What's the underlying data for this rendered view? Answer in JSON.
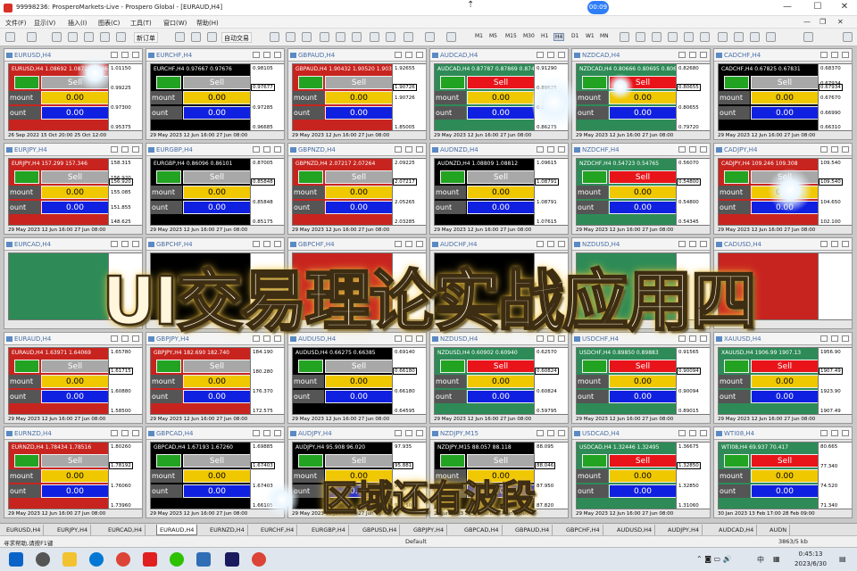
{
  "window": {
    "title": "99998236: ProsperoMarkets-Live - Prospero Global - [EURAUD,H4]",
    "timer": "00:09"
  },
  "menu": [
    "文件(F)",
    "显示(V)",
    "插入(I)",
    "图表(C)",
    "工具(T)",
    "窗口(W)",
    "帮助(H)"
  ],
  "toolbar": {
    "new_order": "新订单",
    "auto_trade": "自动交易",
    "timeframes": [
      "M1",
      "M5",
      "M15",
      "M30",
      "H1",
      "H4",
      "D1",
      "W1",
      "MN"
    ]
  },
  "labels": {
    "sell": "Sell",
    "amount": "mount",
    "count": "ount",
    "amount_alt": "amount",
    "value": "0.00"
  },
  "colors": {
    "red_bg": "#c8241f",
    "green_bg": "#2e8b57",
    "black_bg": "#000000",
    "sell_red": "#e8141a",
    "sell_gray": "#a8a8a8",
    "amount_yellow": "#f0c800",
    "count_blue": "#1020e0"
  },
  "charts": [
    {
      "window": "EURUSD,H4",
      "header": "EURUSD,H4 1.08692 1.08725 1.08666",
      "bg": "red",
      "sell": "gray",
      "prices": [
        "1.01150",
        "0.99225",
        "0.97300",
        "0.95375"
      ],
      "current": "",
      "x": "26 Sep 2022   15 Oct 20:00   25 Oct 12:00"
    },
    {
      "window": "EURCHF,H4",
      "header": "EURCHF,H4 0.97667 0.97676",
      "bg": "black",
      "sell": "gray",
      "prices": [
        "0.98105",
        "0.97870",
        "0.97285",
        "0.96685"
      ],
      "current": "0.97677",
      "x": "29 May 2023   12 Jun 16:00   27 Jun 08:00"
    },
    {
      "window": "GBPAUD,H4",
      "header": "GBPAUD,H4 1.90432 1.90520 1.90387",
      "bg": "red",
      "sell": "gray",
      "prices": [
        "1.92655",
        "1.90726",
        "1.85005"
      ],
      "current": "1.90726",
      "x": "29 May 2023   12 Jun 16:00   27 Jun 08:00"
    },
    {
      "window": "AUDCAD,H4",
      "header": "AUDCAD,H4 0.87787 0.87869 0.87450",
      "bg": "green",
      "sell": "red",
      "prices": [
        "0.91290",
        "0.89625",
        "0.87950",
        "0.86275"
      ],
      "current": "",
      "x": "29 May 2023   12 Jun 16:00   27 Jun 08:00"
    },
    {
      "window": "NZDCAD,H4",
      "header": "NZDCAD,H4 0.80666 0.80695 0.80615",
      "bg": "green",
      "sell": "red",
      "prices": [
        "0.82680",
        "0.81200",
        "0.80655",
        "0.79720"
      ],
      "current": "0.80655",
      "x": "29 May 2023   12 Jun 16:00   27 Jun 08:00"
    },
    {
      "window": "CADCHF,H4",
      "header": "CADCHF,H4 0.67825 0.67831",
      "bg": "black",
      "sell": "gray",
      "prices": [
        "0.68370",
        "0.67934",
        "0.67670",
        "0.66990",
        "0.66310"
      ],
      "current": "0.67934",
      "x": "29 May 2023   12 Jun 16:00   27 Jun 08:00"
    },
    {
      "window": "EURJPY,H4",
      "header": "EURJPY,H4 157.299 157.346",
      "bg": "red",
      "sell": "gray",
      "prices": [
        "158.315",
        "156.920",
        "155.085",
        "151.855",
        "148.625"
      ],
      "current": "156.920",
      "x": "29 May 2023   12 Jun 16:00   27 Jun 08:00"
    },
    {
      "window": "EURGBP,H4",
      "header": "EURGBP,H4 0.86096 0.86101",
      "bg": "black",
      "sell": "gray",
      "prices": [
        "0.87005",
        "0.86390",
        "0.85848",
        "0.85175"
      ],
      "current": "0.85848",
      "x": "29 May 2023   12 Jun 16:00   27 Jun 08:00"
    },
    {
      "window": "GBPNZD,H4",
      "header": "GBPNZD,H4 2.07217 2.07264",
      "bg": "red",
      "sell": "gray",
      "prices": [
        "2.09225",
        "2.07217",
        "2.05265",
        "2.03285"
      ],
      "current": "2.07217",
      "x": "29 May 2023   12 Jun 16:00   27 Jun 08:00"
    },
    {
      "window": "AUDNZD,H4",
      "header": "AUDNZD,H4 1.08809 1.08812",
      "bg": "black",
      "sell": "gray",
      "prices": [
        "1.09615",
        "1.08805",
        "1.08791",
        "1.07615"
      ],
      "current": "1.08791",
      "x": "29 May 2023   12 Jun 16:00   27 Jun 08:00"
    },
    {
      "window": "NZDCHF,H4",
      "header": "NZDCHF,H4 0.54723 0.54765",
      "bg": "green",
      "sell": "red",
      "prices": [
        "0.56070",
        "0.55300",
        "0.54800",
        "0.54345"
      ],
      "current": "0.54800",
      "x": "29 May 2023   12 Jun 16:00   27 Jun 08:00"
    },
    {
      "window": "CADJPY,H4",
      "header": "CADJPY,H4 109.246 109.308",
      "bg": "red",
      "sell": "gray",
      "prices": [
        "109.540",
        "107.200",
        "104.650",
        "102.100"
      ],
      "current": "109.540",
      "x": "29 May 2023   12 Jun 16:00   27 Jun 08:00"
    },
    {
      "window": "EURCAD,H4",
      "header": "",
      "bg": "green",
      "sell": "",
      "prices": [],
      "current": "",
      "x": ""
    },
    {
      "window": "GBPCHF,H4",
      "header": "",
      "bg": "black",
      "sell": "",
      "prices": [],
      "current": "",
      "x": ""
    },
    {
      "window": "GBPCHF,H4",
      "header": "",
      "bg": "red",
      "sell": "",
      "prices": [],
      "current": "",
      "x": ""
    },
    {
      "window": "AUDCHF,H4",
      "header": "",
      "bg": "black",
      "sell": "",
      "prices": [],
      "current": "",
      "x": ""
    },
    {
      "window": "NZDUSD,H4",
      "header": "",
      "bg": "green",
      "sell": "",
      "prices": [],
      "current": "",
      "x": ""
    },
    {
      "window": "CADUSD,H4",
      "header": "",
      "bg": "red",
      "sell": "",
      "prices": [],
      "current": "",
      "x": ""
    },
    {
      "window": "EURAUD,H4",
      "header": "EURAUD,H4 1.63971 1.64069",
      "bg": "red",
      "sell": "gray",
      "prices": [
        "1.65780",
        "1.61715",
        "1.60880",
        "1.58500"
      ],
      "current": "1.61715",
      "x": "29 May 2023   12 Jun 16:00   27 Jun 08:00"
    },
    {
      "window": "GBPJPY,H4",
      "header": "GBPJPY,H4 182.690 182.740",
      "bg": "red",
      "sell": "gray",
      "prices": [
        "184.190",
        "180.280",
        "176.370",
        "172.575"
      ],
      "current": "",
      "x": "29 May 2023   12 Jun 16:00   27 Jun 08:00"
    },
    {
      "window": "AUDUSD,H4",
      "header": "AUDUSD,H4 0.66275 0.66385",
      "bg": "black",
      "sell": "gray",
      "prices": [
        "0.69140",
        "0.67590",
        "0.66180",
        "0.64595"
      ],
      "current": "0.66180",
      "x": "29 May 2023   12 Jun 16:00   27 Jun 08:00"
    },
    {
      "window": "NZDUSD,H4",
      "header": "NZDUSD,H4 0.60902 0.60940",
      "bg": "green",
      "sell": "red",
      "prices": [
        "0.62570",
        "0.61645",
        "0.60824",
        "0.59795"
      ],
      "current": "0.60824",
      "x": "29 May 2023   12 Jun 16:00   27 Jun 08:00"
    },
    {
      "window": "USDCHF,H4",
      "header": "USDCHF,H4 0.89850 0.89883",
      "bg": "green",
      "sell": "red",
      "prices": [
        "0.91565",
        "0.90715",
        "0.90094",
        "0.89015"
      ],
      "current": "0.90094",
      "x": "29 May 2023   12 Jun 16:00   27 Jun 08:00"
    },
    {
      "window": "XAUUSD,H4",
      "header": "XAUUSD,H4 1906.99 1907.13",
      "bg": "green",
      "sell": "red",
      "prices": [
        "1956.90",
        "1940.15",
        "1923.90",
        "1907.49"
      ],
      "current": "1907.49",
      "x": "29 May 2023   12 Jun 16:00   27 Jun 08:00"
    },
    {
      "window": "EURNZD,H4",
      "header": "EURNZD,H4 1.78434 1.78516",
      "bg": "red",
      "sell": "gray",
      "prices": [
        "1.80260",
        "1.78192",
        "1.76060",
        "1.73960"
      ],
      "current": "1.78192",
      "x": "29 May 2023   12 Jun 16:00   27 Jun 08:00"
    },
    {
      "window": "GBPCAD,H4",
      "header": "GBPCAD,H4 1.67193 1.67260",
      "bg": "black",
      "sell": "gray",
      "prices": [
        "1.69885",
        "1.68625",
        "1.67403",
        "1.66105"
      ],
      "current": "1.67403",
      "x": "29 May 2023   12 Jun 16:00   27 Jun 08:00"
    },
    {
      "window": "AUDJPY,H4",
      "header": "AUDJPY,H4 95.908 96.020",
      "bg": "black",
      "sell": "gray",
      "prices": [
        "97.935",
        "95.881",
        "95.350",
        "93.750"
      ],
      "current": "95.881",
      "x": "29 May 2023   12 Jun 16:00   27 Jun 08:00"
    },
    {
      "window": "NZDJPY,M15",
      "header": "NZDJPY,M15 88.057 88.118",
      "bg": "black",
      "sell": "gray",
      "prices": [
        "88.095",
        "88.046",
        "87.950",
        "87.820"
      ],
      "current": "88.046",
      "x": "26 Jun 2023   27 Jun 00:00   27 Jun 13:00"
    },
    {
      "window": "USDCAD,H4",
      "header": "USDCAD,H4 1.32446 1.32495",
      "bg": "green",
      "sell": "red",
      "prices": [
        "1.36675",
        "1.34870",
        "1.32850",
        "1.31060"
      ],
      "current": "1.32850",
      "x": "29 May 2023   12 Jun 16:00   27 Jun 08:00"
    },
    {
      "window": "WTI08,H4",
      "header": "WTI08,H4 69.937 70.417",
      "bg": "green",
      "sell": "red",
      "prices": [
        "80.665",
        "77.340",
        "74.520",
        "71.340"
      ],
      "current": "",
      "x": "30 Jan 2023   13 Feb 17:00   28 Feb 09:00"
    }
  ],
  "overlay": {
    "title": "UI交易理论实战应用四",
    "subtitle": "区域还有波段"
  },
  "tabs": [
    "EURUSD,H4",
    "EURJPY,H4",
    "EURCAD,H4",
    "EURAUD,H4",
    "EURNZD,H4",
    "EURCHF,H4",
    "EURGBP,H4",
    "GBPUSD,H4",
    "GBPJPY,H4",
    "GBPCAD,H4",
    "GBPAUD,H4",
    "GBPCHF,H4",
    "AUDUSD,H4",
    "AUDJPY,H4",
    "AUDCAD,H4",
    "AUDN"
  ],
  "active_tab": "EURAUD,H4",
  "status": {
    "help": "寻求帮助,请按F1键",
    "profile": "Default",
    "traffic": "3863/5 kb"
  },
  "taskbar": {
    "lang": "中",
    "time": "0:45:13",
    "date": "2023/6/30"
  }
}
